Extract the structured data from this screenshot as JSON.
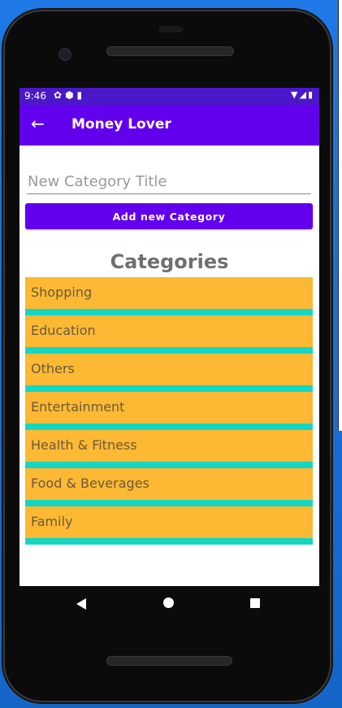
{
  "status_bar": {
    "time": "9:46"
  },
  "app_bar": {
    "title": "Money Lover"
  },
  "form": {
    "placeholder": "New Category Title",
    "value": "",
    "button_label": "Add new Category"
  },
  "categories_section": {
    "title": "Categories",
    "items": [
      {
        "label": "Shopping"
      },
      {
        "label": "Education"
      },
      {
        "label": "Others"
      },
      {
        "label": "Entertainment"
      },
      {
        "label": "Health & Fitness"
      },
      {
        "label": "Food & Beverages"
      },
      {
        "label": "Family"
      }
    ]
  },
  "colors": {
    "app_bar": "#6200ee",
    "status_bar": "#4a18c8",
    "category_background": "#fdb933",
    "category_divider": "#14d6c4"
  },
  "icons": {
    "back": "arrow-left-icon",
    "nav_back": "triangle-back-icon",
    "nav_home": "circle-home-icon",
    "nav_recent": "square-recents-icon"
  }
}
